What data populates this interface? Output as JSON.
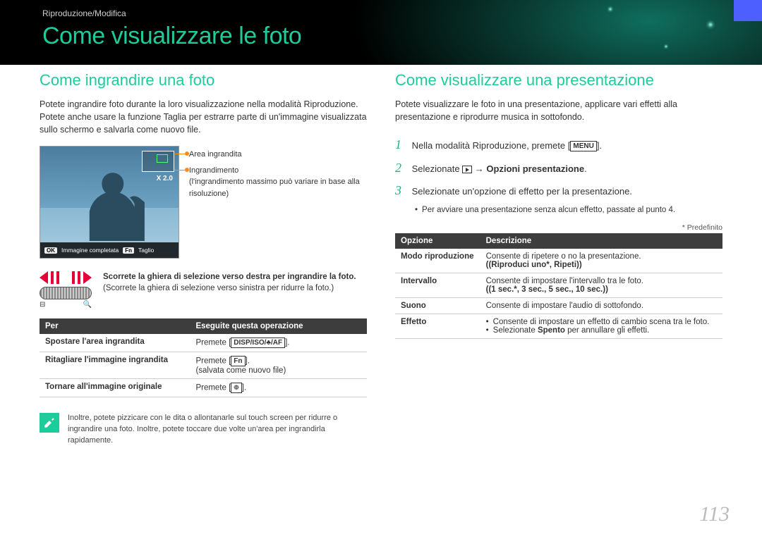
{
  "header": {
    "breadcrumb": "Riproduzione/Modifica",
    "title": "Come visualizzare le foto"
  },
  "left": {
    "section_title": "Come ingrandire una foto",
    "intro": "Potete ingrandire foto durante la loro visualizzazione nella modalità Riproduzione. Potete anche usare la funzione Taglia per estrarre parte di un'immagine visualizzata sullo schermo e salvarla come nuovo file.",
    "legend": {
      "area": "Area ingrandita",
      "zoom": "Ingrandimento",
      "zoom_note": "(l'ingrandimento massimo può variare in base alla risoluzione)"
    },
    "zoom_value": "X 2.0",
    "status": {
      "ok": "OK",
      "ok_label": "Immagine completata",
      "fn": "Fn",
      "fn_label": "Taglio"
    },
    "wheel": {
      "title": "Scorrete la ghiera di selezione verso destra per ingrandire la foto.",
      "sub": "(Scorrete la ghiera di selezione verso sinistra per ridurre la foto.)"
    },
    "table": {
      "h1": "Per",
      "h2": "Eseguite questa operazione",
      "rows": [
        {
          "a": "Spostare l'area ingrandita",
          "b_pre": "Premete [",
          "b_btn": "DISP/ISO/♣/AF",
          "b_post": "]."
        },
        {
          "a": "Ritagliare l'immagine ingrandita",
          "b_pre": "Premete [",
          "b_btn": "Fn",
          "b_post": "].",
          "b_sub": "(salvata come nuovo file)"
        },
        {
          "a": "Tornare all'immagine originale",
          "b_pre": "Premete [",
          "b_btn": "⯐",
          "b_post": "]."
        }
      ]
    },
    "note": "Inoltre, potete pizzicare con le dita o allontanarle sul touch screen per ridurre o ingrandire una foto. Inoltre, potete toccare due volte un'area per ingrandirla rapidamente."
  },
  "right": {
    "section_title": "Come visualizzare una presentazione",
    "intro": "Potete visualizzare le foto in una presentazione, applicare vari effetti alla presentazione e riprodurre musica in sottofondo.",
    "steps": [
      {
        "n": "1",
        "pre": "Nella modalità Riproduzione, premete [",
        "btn": "MENU",
        "post": "]."
      },
      {
        "n": "2",
        "pre": "Selezionate ",
        "icon": "play",
        "mid": " → ",
        "bold": "Opzioni presentazione",
        "post": "."
      },
      {
        "n": "3",
        "text": "Selezionate un'opzione di effetto per la presentazione.",
        "sub": "Per avviare una presentazione senza alcun effetto, passate al punto 4."
      }
    ],
    "predef": "* Predefinito",
    "table": {
      "h1": "Opzione",
      "h2": "Descrizione",
      "rows": [
        {
          "a": "Modo riproduzione",
          "b": "Consente di ripetere o no la presentazione.",
          "b_bold": "(Riproduci uno*, Ripeti)"
        },
        {
          "a": "Intervallo",
          "b": "Consente di impostare l'intervallo tra le foto.",
          "b_bold": "(1 sec.*, 3 sec., 5 sec., 10 sec.)"
        },
        {
          "a": "Suono",
          "b": "Consente di impostare l'audio di sottofondo."
        },
        {
          "a": "Effetto",
          "bullets": [
            "Consente di impostare un effetto di cambio scena tra le foto.",
            {
              "pre": "Selezionate ",
              "bold": "Spento",
              "post": " per annullare gli effetti."
            }
          ]
        }
      ]
    }
  },
  "page_number": "113"
}
